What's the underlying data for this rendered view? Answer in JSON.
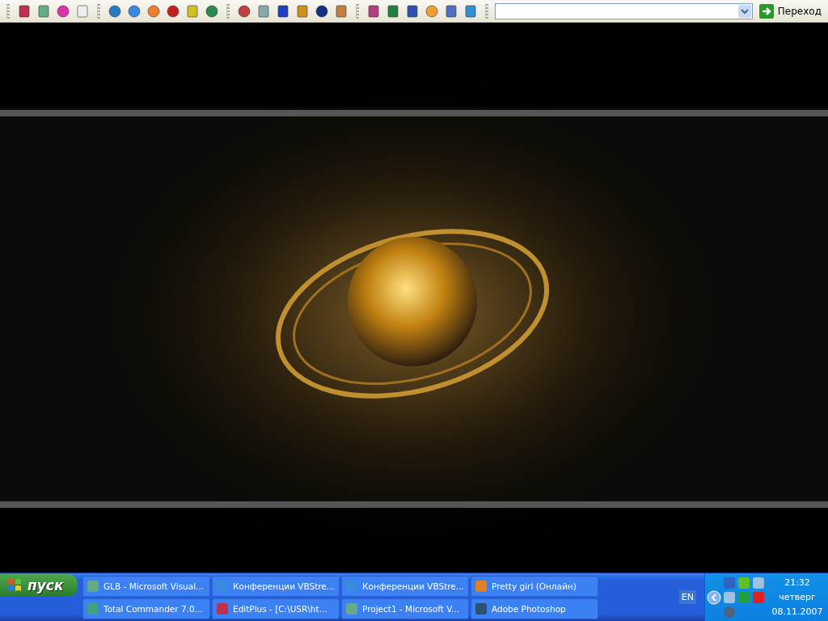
{
  "toolbar": {
    "go_button": {
      "label": "Переход"
    }
  },
  "taskbar": {
    "start_button": {
      "label": "пуск"
    },
    "buttons": [
      {
        "label": "GLB - Microsoft Visual..."
      },
      {
        "label": "Конференции VBStre..."
      },
      {
        "label": "Конференции VBStre..."
      },
      {
        "label": "Pretty girl (Онлайн)"
      },
      {
        "label": "Total Commander 7.0..."
      },
      {
        "label": "EditPlus - [C:\\USR\\ht..."
      },
      {
        "label": "Project1 - Microsoft V..."
      },
      {
        "label": "Adobe Photoshop"
      }
    ],
    "language": "EN",
    "clock": {
      "time": "21:32",
      "weekday": "четверг",
      "date": "08.11.2007"
    }
  }
}
